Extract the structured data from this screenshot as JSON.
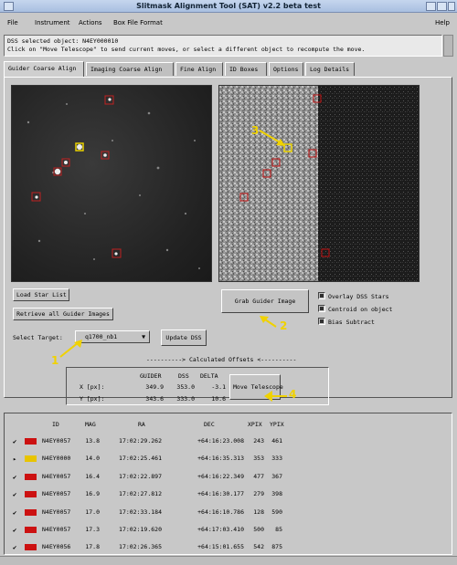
{
  "window": {
    "title": "Slitmask Alignment Tool (SAT) v2.2 beta test"
  },
  "menu": {
    "file": "File",
    "instrument": "Instrument",
    "actions": "Actions",
    "box_file_format": "Box File Format",
    "help": "Help"
  },
  "messages": {
    "line1": "DSS selected object: N4EY000010",
    "line2": "Click on \"Move Telescope\" to send current moves, or select a different object to recompute the move."
  },
  "tabs": [
    "Guider Coarse Align",
    "Imaging Coarse Align",
    "Fine Align",
    "ID Boxes",
    "Options",
    "Log Details"
  ],
  "controls": {
    "load_star_list": "Load Star List",
    "retrieve_guider": "Retrieve all Guider Images",
    "select_target_label": "Select Target:",
    "target_value": "q1700_nb1",
    "update_dss": "Update DSS",
    "grab_guider": "Grab Guider Image",
    "overlay_dss": "Overlay DSS Stars",
    "centroid": "Centroid on object",
    "bias": "Bias Subtract"
  },
  "checkbox_state": {
    "overlay_dss": true,
    "centroid": true,
    "bias": true
  },
  "annotations": {
    "n1": "1",
    "n2": "2",
    "n3": "3",
    "n4": "4"
  },
  "offsets": {
    "title": "----------> Calculated Offsets <----------",
    "col_guider": "GUIDER",
    "col_dss": "DSS",
    "col_delta": "DELTA",
    "x_label": "X [px]:",
    "y_label": "Y [px]:",
    "x_guider": "349.9",
    "x_dss": "353.0",
    "x_delta": "-3.1",
    "y_guider": "343.6",
    "y_dss": "333.0",
    "y_delta": "10.6",
    "move_telescope": "Move Telescope"
  },
  "table": {
    "headers": {
      "id": "ID",
      "mag": "MAG",
      "ra": "RA",
      "dec": "DEC",
      "xpix": "XPIX",
      "ypix": "YPIX"
    },
    "rows": [
      {
        "color": "#cc1111",
        "id": "N4EY0057",
        "mag": "13.8",
        "ra": "17:02:29.262",
        "dec": "+64:16:23.008",
        "xpix": "243",
        "ypix": "461",
        "marker": "✔"
      },
      {
        "color": "#e8c400",
        "id": "N4EY0000",
        "mag": "14.0",
        "ra": "17:02:25.461",
        "dec": "+64:16:35.313",
        "xpix": "353",
        "ypix": "333",
        "marker": "▸"
      },
      {
        "color": "#cc1111",
        "id": "N4EY0057",
        "mag": "16.4",
        "ra": "17:02:22.897",
        "dec": "+64:16:22.349",
        "xpix": "477",
        "ypix": "367",
        "marker": "✔"
      },
      {
        "color": "#cc1111",
        "id": "N4EY0057",
        "mag": "16.9",
        "ra": "17:02:27.812",
        "dec": "+64:16:30.177",
        "xpix": "279",
        "ypix": "398",
        "marker": "✔"
      },
      {
        "color": "#cc1111",
        "id": "N4EY0057",
        "mag": "17.0",
        "ra": "17:02:33.184",
        "dec": "+64:16:10.786",
        "xpix": "128",
        "ypix": "590",
        "marker": "✔"
      },
      {
        "color": "#cc1111",
        "id": "N4EY0057",
        "mag": "17.3",
        "ra": "17:02:19.620",
        "dec": "+64:17:03.410",
        "xpix": "500",
        "ypix": "85",
        "marker": "✔"
      },
      {
        "color": "#cc1111",
        "id": "N4EY0056",
        "mag": "17.8",
        "ra": "17:02:26.365",
        "dec": "+64:15:01.655",
        "xpix": "542",
        "ypix": "875",
        "marker": "✔"
      }
    ]
  }
}
